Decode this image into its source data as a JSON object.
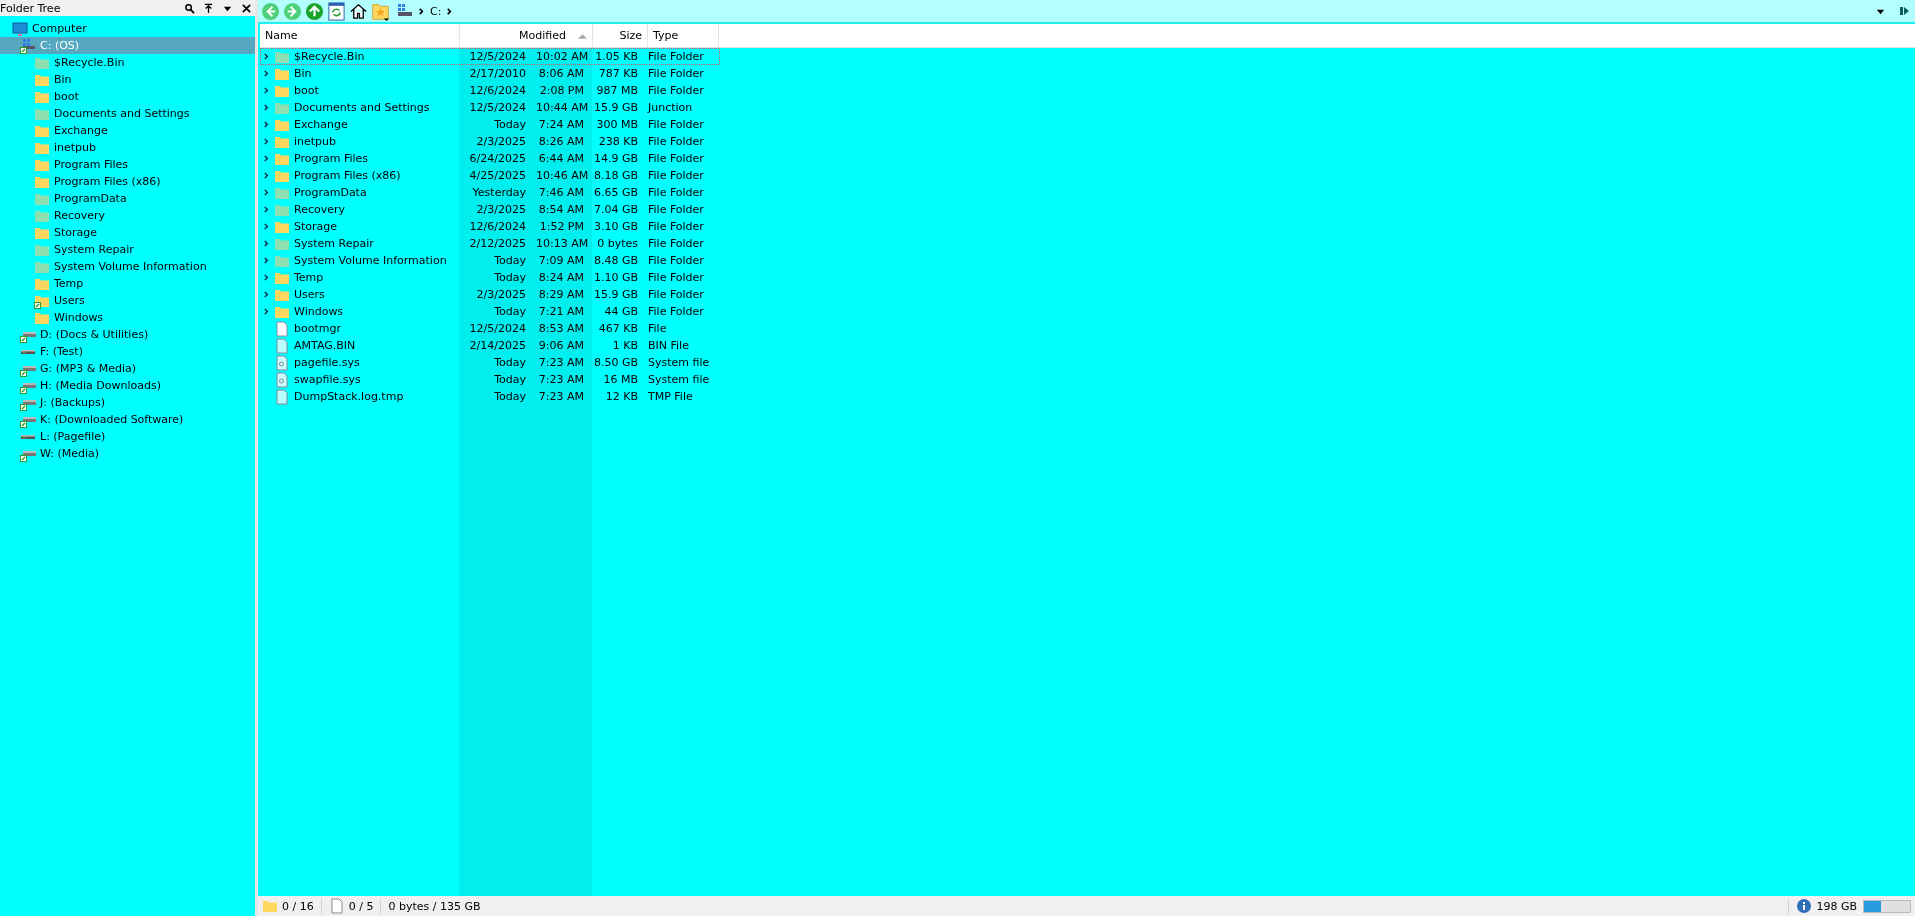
{
  "folder_tree": {
    "title": "Folder Tree",
    "root": {
      "label": "Computer",
      "kind": "computer",
      "selected": false,
      "children": [
        {
          "label": "C: (OS)",
          "kind": "os-drive",
          "selected": true,
          "children": [
            {
              "label": "$Recycle.Bin",
              "kind": "system-folder",
              "selected": false
            },
            {
              "label": "Bin",
              "kind": "folder",
              "selected": false
            },
            {
              "label": "boot",
              "kind": "folder",
              "selected": false
            },
            {
              "label": "Documents and Settings",
              "kind": "system-folder",
              "selected": false
            },
            {
              "label": "Exchange",
              "kind": "folder",
              "selected": false
            },
            {
              "label": "inetpub",
              "kind": "folder",
              "selected": false
            },
            {
              "label": "Program Files",
              "kind": "folder",
              "selected": false
            },
            {
              "label": "Program Files (x86)",
              "kind": "folder",
              "selected": false
            },
            {
              "label": "ProgramData",
              "kind": "system-folder",
              "selected": false
            },
            {
              "label": "Recovery",
              "kind": "system-folder",
              "selected": false
            },
            {
              "label": "Storage",
              "kind": "folder",
              "selected": false
            },
            {
              "label": "System Repair",
              "kind": "system-folder",
              "selected": false
            },
            {
              "label": "System Volume Information",
              "kind": "system-folder",
              "selected": false
            },
            {
              "label": "Temp",
              "kind": "folder",
              "selected": false
            },
            {
              "label": "Users",
              "kind": "shared-folder",
              "selected": false
            },
            {
              "label": "Windows",
              "kind": "folder",
              "selected": false
            }
          ]
        },
        {
          "label": "D: (Docs & Utilities)",
          "kind": "shared-drive",
          "selected": false
        },
        {
          "label": "F: (Test)",
          "kind": "drive",
          "selected": false
        },
        {
          "label": "G: (MP3 & Media)",
          "kind": "shared-drive",
          "selected": false
        },
        {
          "label": "H: (Media Downloads)",
          "kind": "shared-drive",
          "selected": false
        },
        {
          "label": "J: (Backups)",
          "kind": "shared-drive",
          "selected": false
        },
        {
          "label": "K: (Downloaded Software)",
          "kind": "shared-drive",
          "selected": false
        },
        {
          "label": "L: (Pagefile)",
          "kind": "drive",
          "selected": false
        },
        {
          "label": "W: (Media)",
          "kind": "shared-drive",
          "selected": false
        }
      ]
    }
  },
  "breadcrumb": [
    "C:"
  ],
  "table": {
    "columns": [
      {
        "label": "Name",
        "sorted": false
      },
      {
        "label": "Modified",
        "sorted": true
      },
      {
        "label": "Size",
        "sorted": false
      },
      {
        "label": "Type",
        "sorted": false
      }
    ],
    "rows": [
      {
        "name": "$Recycle.Bin",
        "kind": "system-folder",
        "date": "12/5/2024",
        "time": "10:02 AM",
        "size": "1.05 KB",
        "type": "File Folder",
        "focused": true
      },
      {
        "name": "Bin",
        "kind": "folder",
        "date": "2/17/2010",
        "time": "8:06 AM",
        "size": "787 KB",
        "type": "File Folder",
        "focused": false
      },
      {
        "name": "boot",
        "kind": "folder",
        "date": "12/6/2024",
        "time": "2:08 PM",
        "size": "987 MB",
        "type": "File Folder",
        "focused": false
      },
      {
        "name": "Documents and Settings",
        "kind": "system-folder",
        "date": "12/5/2024",
        "time": "10:44 AM",
        "size": "15.9 GB",
        "type": "Junction",
        "focused": false
      },
      {
        "name": "Exchange",
        "kind": "folder",
        "date": "Today",
        "time": "7:24 AM",
        "size": "300 MB",
        "type": "File Folder",
        "focused": false
      },
      {
        "name": "inetpub",
        "kind": "folder",
        "date": "2/3/2025",
        "time": "8:26 AM",
        "size": "238 KB",
        "type": "File Folder",
        "focused": false
      },
      {
        "name": "Program Files",
        "kind": "folder",
        "date": "6/24/2025",
        "time": "6:44 AM",
        "size": "14.9 GB",
        "type": "File Folder",
        "focused": false
      },
      {
        "name": "Program Files (x86)",
        "kind": "folder",
        "date": "4/25/2025",
        "time": "10:46 AM",
        "size": "8.18 GB",
        "type": "File Folder",
        "focused": false
      },
      {
        "name": "ProgramData",
        "kind": "system-folder",
        "date": "Yesterday",
        "time": "7:46 AM",
        "size": "6.65 GB",
        "type": "File Folder",
        "focused": false
      },
      {
        "name": "Recovery",
        "kind": "system-folder",
        "date": "2/3/2025",
        "time": "8:54 AM",
        "size": "7.04 GB",
        "type": "File Folder",
        "focused": false
      },
      {
        "name": "Storage",
        "kind": "folder",
        "date": "12/6/2024",
        "time": "1:52 PM",
        "size": "3.10 GB",
        "type": "File Folder",
        "focused": false
      },
      {
        "name": "System Repair",
        "kind": "system-folder",
        "date": "2/12/2025",
        "time": "10:13 AM",
        "size": "0 bytes",
        "type": "File Folder",
        "focused": false
      },
      {
        "name": "System Volume Information",
        "kind": "system-folder",
        "date": "Today",
        "time": "7:09 AM",
        "size": "8.48 GB",
        "type": "File Folder",
        "focused": false
      },
      {
        "name": "Temp",
        "kind": "folder",
        "date": "Today",
        "time": "8:24 AM",
        "size": "1.10 GB",
        "type": "File Folder",
        "focused": false
      },
      {
        "name": "Users",
        "kind": "folder",
        "date": "2/3/2025",
        "time": "8:29 AM",
        "size": "15.9 GB",
        "type": "File Folder",
        "focused": false
      },
      {
        "name": "Windows",
        "kind": "folder",
        "date": "Today",
        "time": "7:21 AM",
        "size": "44 GB",
        "type": "File Folder",
        "focused": false
      },
      {
        "name": "bootmgr",
        "kind": "file",
        "date": "12/5/2024",
        "time": "8:53 AM",
        "size": "467 KB",
        "type": "File",
        "focused": false
      },
      {
        "name": "AMTAG.BIN",
        "kind": "hidden-file",
        "date": "2/14/2025",
        "time": "9:06 AM",
        "size": "1 KB",
        "type": "BIN File",
        "focused": false
      },
      {
        "name": "pagefile.sys",
        "kind": "system-file",
        "date": "Today",
        "time": "7:23 AM",
        "size": "8.50 GB",
        "type": "System file",
        "focused": false
      },
      {
        "name": "swapfile.sys",
        "kind": "system-file",
        "date": "Today",
        "time": "7:23 AM",
        "size": "16 MB",
        "type": "System file",
        "focused": false
      },
      {
        "name": "DumpStack.log.tmp",
        "kind": "hidden-file",
        "date": "Today",
        "time": "7:23 AM",
        "size": "12 KB",
        "type": "TMP File",
        "focused": false
      }
    ]
  },
  "status_bar": {
    "folders": "0 / 16",
    "files": "0 / 5",
    "bytes": "0 bytes / 135 GB",
    "free": "198 GB",
    "level": 0.38
  }
}
